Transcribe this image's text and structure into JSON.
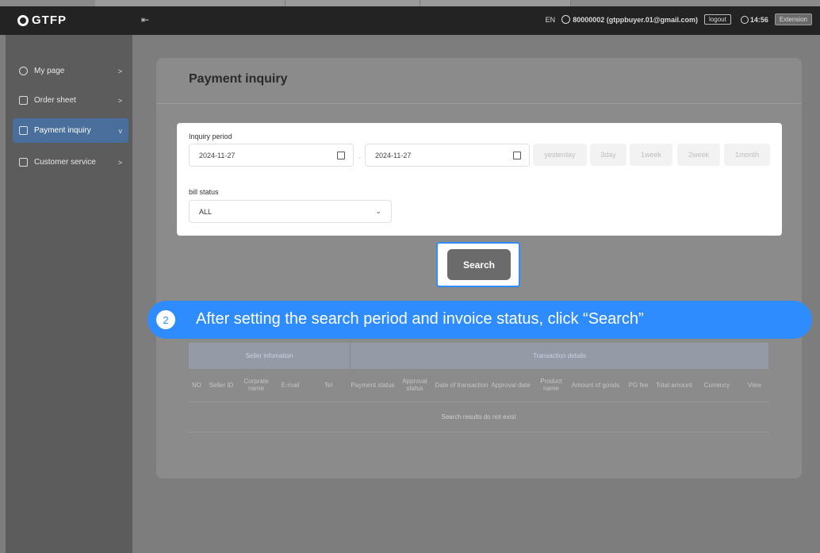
{
  "header": {
    "logo": "GTFP",
    "language": "EN",
    "user": "80000002 (gtppbuyer.01@gmail.com)",
    "logout_label": "logout",
    "time": "14:56",
    "extension_label": "Extension"
  },
  "sidebar": {
    "items": [
      {
        "label": "My page",
        "icon": "user-icon",
        "chevron": ">"
      },
      {
        "label": "Order sheet",
        "icon": "document-icon",
        "chevron": ">"
      },
      {
        "label": "Payment inquiry",
        "icon": "clipboard-icon",
        "chevron": "v"
      },
      {
        "label": "Customer service",
        "icon": "grid-icon",
        "chevron": ">"
      }
    ]
  },
  "main": {
    "title": "Payment inquiry",
    "inquiry_period_label": "Inquiry period",
    "start_date": "2024-11-27",
    "end_date": "2024-11-27",
    "dash": "-",
    "quick_ranges": [
      "yesterday",
      "3day",
      "1week",
      "2week",
      "1month"
    ],
    "bill_status_label": "bill status",
    "bill_status_value": "ALL",
    "search_label": "Search"
  },
  "callout": {
    "step": "2",
    "text": "After setting the search period and invoice status, click “Search”"
  },
  "table": {
    "groups": [
      "Seller infomation",
      "Transaction details"
    ],
    "columns": [
      "NO",
      "Seller ID",
      "Corprate name",
      "E-mail",
      "Tel",
      "Payment status",
      "Approval status",
      "Date of transaction",
      "Approval date",
      "Product name",
      "Amount of goods",
      "PG fee",
      "Total amount",
      "Currency",
      "View"
    ],
    "empty_message": "Search results do not exist"
  },
  "colors": {
    "accent": "#2f8cff",
    "sidebar_active": "#4a6f9c",
    "header_bg": "#232323"
  }
}
